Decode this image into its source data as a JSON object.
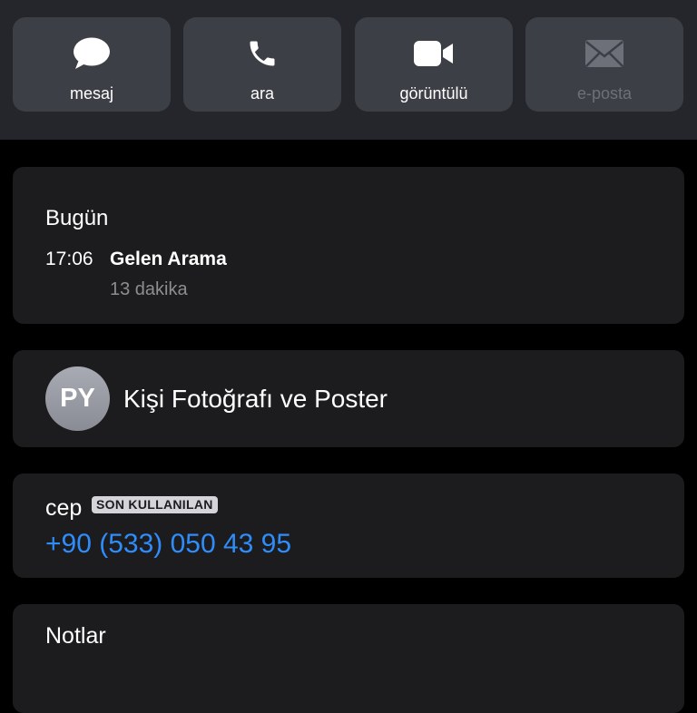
{
  "actions": [
    {
      "label": "mesaj",
      "icon": "message-icon",
      "enabled": true
    },
    {
      "label": "ara",
      "icon": "phone-icon",
      "enabled": true
    },
    {
      "label": "görüntülü",
      "icon": "video-icon",
      "enabled": true
    },
    {
      "label": "e-posta",
      "icon": "mail-icon",
      "enabled": false
    }
  ],
  "recents": {
    "date": "Bugün",
    "time": "17:06",
    "type": "Gelen Arama",
    "duration": "13 dakika"
  },
  "contact": {
    "initials": "PY",
    "poster_label": "Kişi Fotoğrafı ve Poster"
  },
  "phone": {
    "label": "cep",
    "badge": "SON KULLANILAN",
    "number": "+90 (533) 050 43 95"
  },
  "notes": {
    "label": "Notlar"
  },
  "colors": {
    "background": "#000000",
    "header": "#24262b",
    "action_button": "#3d3f46",
    "card": "#1c1c1e",
    "link": "#2f8dfb",
    "secondary_text": "#8d8d92"
  }
}
